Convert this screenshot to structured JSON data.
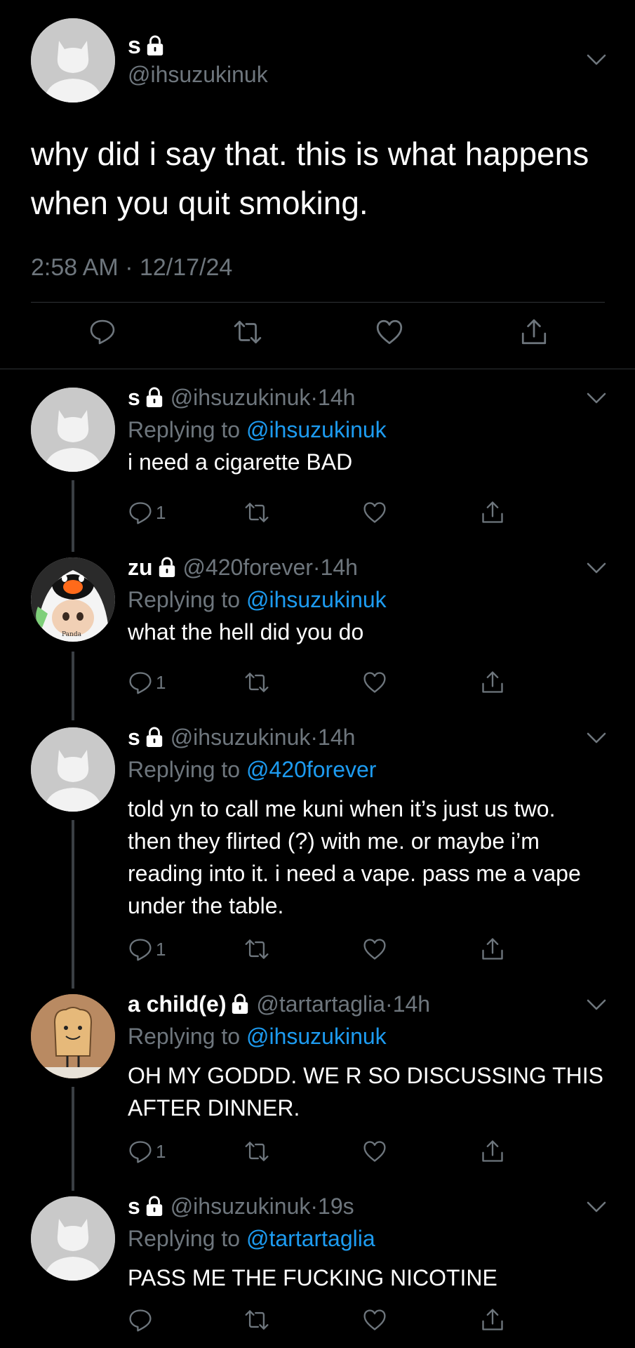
{
  "main_tweet": {
    "name": "s",
    "handle": "@ihsuzukinuk",
    "text": "why did i say that. this is what happens when you quit smoking.",
    "time": "2:58 AM",
    "sep": "·",
    "date": "12/17/24"
  },
  "replies": [
    {
      "name": "s",
      "handle": "@ihsuzukinuk",
      "sep": "·",
      "age": "14h",
      "replying_label": "Replying to",
      "replying_to": "@ihsuzukinuk",
      "text": "i need a cigarette BAD",
      "reply_count": "1"
    },
    {
      "name": "zu",
      "handle": "@420forever",
      "sep": "·",
      "age": "14h",
      "replying_label": "Replying to",
      "replying_to": "@ihsuzukinuk",
      "text": "what the hell did you do",
      "reply_count": "1"
    },
    {
      "name": "s",
      "handle": "@ihsuzukinuk",
      "sep": "·",
      "age": "14h",
      "replying_label": "Replying to",
      "replying_to": "@420forever",
      "text": "told yn to call me kuni when it’s just us two. then they flirted (?) with me. or maybe i’m reading into it. i need a vape. pass me a vape under the table.",
      "reply_count": "1"
    },
    {
      "name": "a child(e)",
      "handle": "@tartartaglia",
      "sep": "·",
      "age": "14h",
      "replying_label": "Replying to",
      "replying_to": "@ihsuzukinuk",
      "text": "OH MY GODDD. WE R SO DISCUSSING THIS AFTER DINNER.",
      "reply_count": "1"
    },
    {
      "name": "s",
      "handle": "@ihsuzukinuk",
      "sep": "·",
      "age": "19s",
      "replying_label": "Replying to",
      "replying_to": "@tartartaglia",
      "text": "PASS ME THE FUCKING NICOTINE",
      "reply_count": ""
    }
  ],
  "colors": {
    "background": "#000000",
    "secondary_text": "#6e767d",
    "link": "#1d9bf0"
  },
  "icons": [
    "lock-icon",
    "chevron-down-icon",
    "reply-icon",
    "retweet-icon",
    "like-icon",
    "share-icon"
  ]
}
